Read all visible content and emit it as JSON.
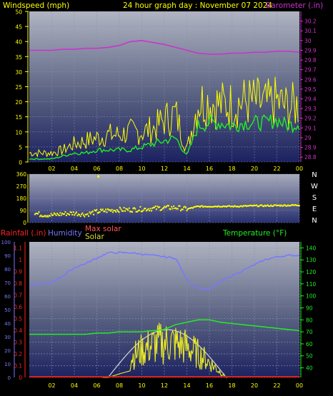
{
  "header": {
    "wind_title": "Windspeed (mph)",
    "date_title": "24 hour graph day : November 07 2024",
    "baro_title": "Barometer (.in)"
  },
  "lower_header": {
    "rain_title": "Rainfall (.in)",
    "humidity_title": "Humidity",
    "maxsolar_title": "Max solar",
    "solar_title": "Solar",
    "temp_title": "Temperature (°F)"
  },
  "colors": {
    "background": "#000000",
    "wind_axis": "#ffff00",
    "baro_axis": "#cc33cc",
    "barometer": "#cc33cc",
    "gust": "#ffff00",
    "avg_wind": "#22ee22",
    "direction": "#ffff00",
    "rain_axis": "#ff2222",
    "humidity": "#7777ff",
    "temperature": "#22ee22",
    "solar": "#eeee22",
    "max_solar": "#cccccc"
  },
  "chart_data": [
    {
      "type": "line",
      "name": "wind-barometer",
      "x_ticks": [
        "02",
        "04",
        "06",
        "08",
        "10",
        "12",
        "14",
        "16",
        "18",
        "20",
        "22",
        "00"
      ],
      "y_left_ticks": [
        "0",
        "5",
        "10",
        "15",
        "20",
        "25",
        "30",
        "35",
        "40",
        "45",
        "50"
      ],
      "y_left_lim": [
        0,
        50
      ],
      "y_right_ticks": [
        "28.8",
        "28.9",
        "29",
        "29.1",
        "29.2",
        "29.3",
        "29.4",
        "29.5",
        "29.6",
        "29.7",
        "29.8",
        "29.9",
        "30",
        "30.1",
        "30.2"
      ],
      "y_right_lim": [
        28.75,
        30.3
      ],
      "x": [
        0,
        1,
        2,
        3,
        4,
        5,
        6,
        7,
        8,
        9,
        10,
        11,
        12,
        13,
        14,
        15,
        16,
        17,
        18,
        19,
        20,
        21,
        22,
        23,
        24
      ],
      "series": [
        {
          "values": [
            29.9,
            29.9,
            29.9,
            29.91,
            29.91,
            29.92,
            29.92,
            29.93,
            29.95,
            29.99,
            30.0,
            29.98,
            29.96,
            29.93,
            29.9,
            29.87,
            29.86,
            29.86,
            29.87,
            29.87,
            29.88,
            29.88,
            29.89,
            29.89,
            29.88
          ]
        },
        {
          "values": [
            3,
            3,
            3,
            4,
            6,
            7,
            8,
            9,
            9,
            10,
            10,
            11,
            14,
            16,
            4,
            20,
            20,
            19,
            19,
            20,
            20,
            19,
            20,
            18,
            19
          ]
        },
        {
          "values": [
            1,
            1,
            1,
            2,
            3,
            3,
            4,
            4,
            4,
            4,
            5,
            6,
            7,
            8,
            2,
            12,
            13,
            13,
            12,
            13,
            13,
            13,
            14,
            12,
            13
          ]
        }
      ]
    },
    {
      "type": "scatter",
      "name": "wind-direction",
      "y_left_ticks": [
        "0",
        "90",
        "180",
        "270",
        "360"
      ],
      "y_lim": [
        0,
        360
      ],
      "y_right_labels": [
        "N",
        "W",
        "S",
        "E",
        "N"
      ],
      "x": [
        0,
        1,
        2,
        3,
        4,
        5,
        6,
        7,
        8,
        9,
        10,
        11,
        12,
        13,
        14,
        15,
        16,
        17,
        18,
        19,
        20,
        21,
        22,
        23,
        24
      ],
      "series": [
        {
          "values": [
            80,
            60,
            55,
            65,
            70,
            60,
            80,
            90,
            95,
            95,
            100,
            105,
            110,
            112,
            100,
            120,
            120,
            122,
            120,
            122,
            125,
            125,
            127,
            128,
            130
          ]
        }
      ]
    },
    {
      "type": "line",
      "name": "rain-humidity-solar-temperature",
      "y_rain_ticks": [
        "0",
        "0.1",
        "0.2",
        "0.3",
        "0.4",
        "0.5",
        "0.6",
        "0.7",
        "0.8",
        "0.9",
        "1",
        "1.1"
      ],
      "rain_lim": [
        0,
        1.15
      ],
      "y_humidity_ticks": [
        "0",
        "10",
        "20",
        "30",
        "40",
        "50",
        "60",
        "70",
        "80",
        "90",
        "100"
      ],
      "humidity_lim": [
        0,
        100
      ],
      "y_temp_ticks": [
        "40",
        "50",
        "60",
        "70",
        "80",
        "90",
        "100",
        "110",
        "120",
        "130",
        "140"
      ],
      "temp_lim": [
        32,
        145
      ],
      "x_ticks": [
        "02",
        "04",
        "06",
        "08",
        "10",
        "12",
        "14",
        "16",
        "18",
        "20",
        "22",
        "00"
      ],
      "x": [
        0,
        1,
        2,
        3,
        4,
        5,
        6,
        7,
        8,
        9,
        10,
        11,
        12,
        13,
        14,
        15,
        16,
        17,
        18,
        19,
        20,
        21,
        22,
        23,
        24
      ],
      "series": [
        {
          "values": [
            68,
            69,
            70,
            75,
            81,
            84,
            88,
            92,
            92,
            92,
            91,
            90,
            89,
            88,
            72,
            66,
            65,
            71,
            75,
            79,
            83,
            87,
            89,
            90,
            90
          ]
        },
        {
          "values": [
            68,
            68,
            68,
            68,
            68,
            68,
            69,
            69,
            70,
            70,
            70,
            71,
            72,
            76,
            78,
            80,
            80,
            78,
            77,
            76,
            75,
            74,
            73,
            72,
            71
          ]
        },
        {
          "values": [
            0,
            0,
            0,
            0,
            0,
            0,
            0,
            0,
            0,
            0,
            0,
            0,
            0,
            0,
            0,
            0,
            0,
            0,
            0,
            0,
            0,
            0,
            0,
            0,
            0
          ]
        }
      ]
    }
  ]
}
